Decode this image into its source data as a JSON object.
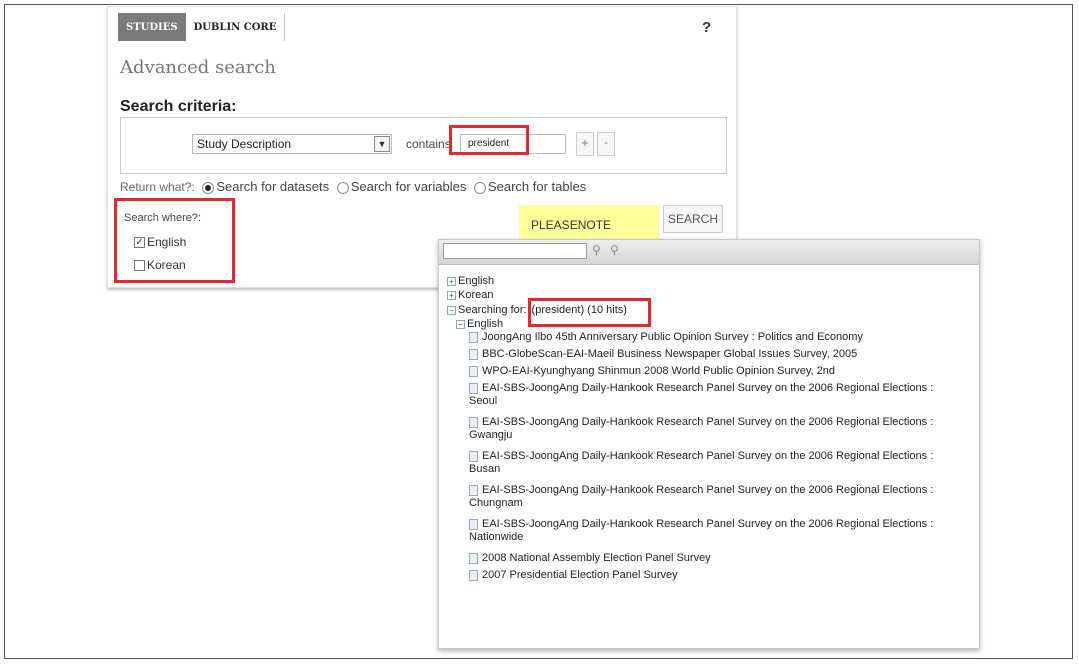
{
  "tabs": [
    {
      "label": "STUDIES",
      "active": true
    },
    {
      "label": "DUBLIN CORE",
      "active": false
    }
  ],
  "help_label": "?",
  "title": "Advanced search",
  "criteria": {
    "label": "Search criteria:",
    "field": "Study Description",
    "operator": "contains",
    "value": "president",
    "add_label": "+",
    "remove_label": "-"
  },
  "return_what": {
    "label": "Return what?:",
    "options": [
      {
        "label": "Search for datasets",
        "selected": true
      },
      {
        "label": "Search for variables",
        "selected": false
      },
      {
        "label": "Search for tables",
        "selected": false
      }
    ]
  },
  "search_where": {
    "label": "Search where?:",
    "options": [
      {
        "label": "English",
        "checked": true
      },
      {
        "label": "Korean",
        "checked": false
      }
    ]
  },
  "note_label": "PLEASENOTE",
  "search_button": "SEARCH",
  "results": {
    "roots": [
      "English",
      "Korean"
    ],
    "searching_label": "Searching for:",
    "query_summary": "(president) (10 hits)",
    "group": "English",
    "items": [
      "JoongAng Ilbo 45th Anniversary Public Opinion Survey : Politics and Economy",
      "BBC-GlobeScan-EAI-Maeil Business Newspaper Global Issues Survey, 2005",
      "WPO-EAI-Kyunghyang Shinmun 2008 World Public Opinion Survey, 2nd",
      "EAI-SBS-JoongAng Daily-Hankook Research Panel Survey on the 2006 Regional Elections : Seoul",
      "EAI-SBS-JoongAng Daily-Hankook Research Panel Survey on the 2006 Regional Elections : Gwangju",
      "EAI-SBS-JoongAng Daily-Hankook Research Panel Survey on the 2006 Regional Elections : Busan",
      "EAI-SBS-JoongAng Daily-Hankook Research Panel Survey on the 2006 Regional Elections : Chungnam",
      "EAI-SBS-JoongAng Daily-Hankook Research Panel Survey on the 2006 Regional Elections : Nationwide",
      "2008 National Assembly Election Panel Survey",
      "2007 Presidential Election Panel Survey"
    ]
  },
  "highlight_color": "#e8262d",
  "note_color": "#ffff99"
}
